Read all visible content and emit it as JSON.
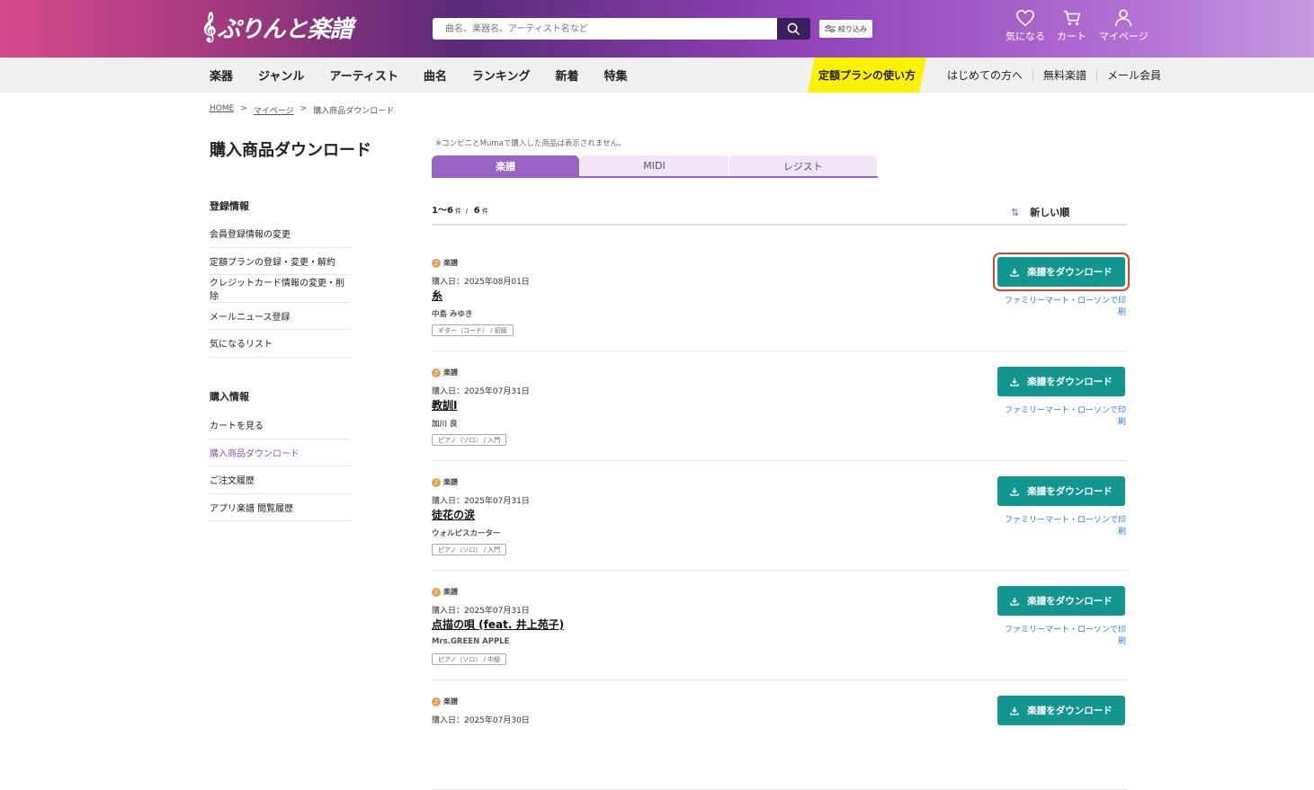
{
  "header": {
    "logo": "ぷりんと楽譜",
    "search_placeholder": "曲名、楽器名、アーティスト名など",
    "filter_label": "絞り込み",
    "icons": [
      {
        "name": "heart-icon",
        "label": "気になる"
      },
      {
        "name": "cart-icon",
        "label": "カート"
      },
      {
        "name": "person-icon",
        "label": "マイページ"
      }
    ]
  },
  "nav": {
    "items": [
      "楽器",
      "ジャンル",
      "アーティスト",
      "曲名",
      "ランキング",
      "新着",
      "特集"
    ],
    "plan": "定額プランの使い方",
    "right": [
      "はじめての方へ",
      "無料楽譜",
      "メール会員"
    ]
  },
  "breadcrumb": [
    "HOME",
    "マイページ",
    "購入商品ダウンロード"
  ],
  "sidebar": {
    "title": "購入商品ダウンロード",
    "sections": [
      {
        "heading": "登録情報",
        "items": [
          "会員登録情報の変更",
          "定額プランの登録・変更・解約",
          "クレジットカード情報の変更・削除",
          "メールニュース登録",
          "気になるリスト"
        ]
      },
      {
        "heading": "購入情報",
        "items": [
          "カートを見る",
          "購入商品ダウンロード",
          "ご注文履歴",
          "アプリ楽譜 閲覧履歴"
        ]
      }
    ]
  },
  "main": {
    "note": "※コンビニとMumaで購入した商品は表示されません。",
    "tabs": [
      "楽譜",
      "MIDI",
      "レジスト"
    ],
    "count": {
      "range": "1〜6",
      "unit1": "件",
      "sep": "/",
      "total": "6",
      "unit2": "件"
    },
    "sort_label": "新しい順",
    "download_label": "楽譜をダウンロード",
    "print_label": "ファミリーマート・ローソンで印刷",
    "items": [
      {
        "category": "楽譜",
        "date": "購入日：2025年08月01日",
        "title": "糸",
        "artist": "中島 みゆき",
        "tag": "ギター（コード） / 初級"
      },
      {
        "category": "楽譜",
        "date": "購入日：2025年07月31日",
        "title": "教訓I",
        "artist": "加川 良",
        "tag": "ピアノ（ソロ） / 入門"
      },
      {
        "category": "楽譜",
        "date": "購入日：2025年07月31日",
        "title": "徒花の涙",
        "artist": "ウォルピスカーター",
        "tag": "ピアノ（ソロ） / 入門"
      },
      {
        "category": "楽譜",
        "date": "購入日：2025年07月31日",
        "title": "点描の唄 (feat. 井上苑子)",
        "artist": "Mrs.GREEN APPLE",
        "tag": "ピアノ（ソロ） / 中級"
      },
      {
        "category": "楽譜",
        "date": "購入日：2025年07月30日",
        "title": "",
        "artist": "",
        "tag": ""
      }
    ]
  }
}
